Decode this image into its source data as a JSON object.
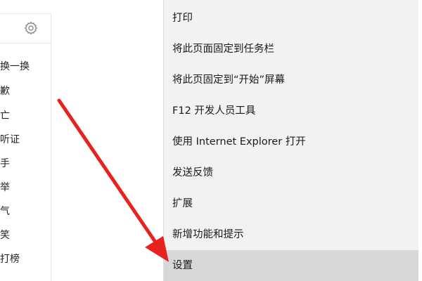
{
  "sidebar": {
    "settings_icon": "gear-icon",
    "items": [
      {
        "label": "换一换"
      },
      {
        "label": "歉"
      },
      {
        "label": "亡"
      },
      {
        "label": "听证"
      },
      {
        "label": "手"
      },
      {
        "label": "举"
      },
      {
        "label": "气"
      },
      {
        "label": "笑"
      },
      {
        "label": "打榜"
      }
    ]
  },
  "context_menu": {
    "items": [
      {
        "label": "打印"
      },
      {
        "label": "将此页面固定到任务栏"
      },
      {
        "label": "将此页固定到“开始”屏幕"
      },
      {
        "label": "F12 开发人员工具"
      },
      {
        "label": "使用 Internet Explorer 打开"
      },
      {
        "label": "发送反馈"
      },
      {
        "label": "扩展"
      },
      {
        "label": "新增功能和提示"
      },
      {
        "label": "设置"
      }
    ],
    "highlighted_item": "设置"
  },
  "annotation": {
    "arrow_color": "#e8231f"
  }
}
